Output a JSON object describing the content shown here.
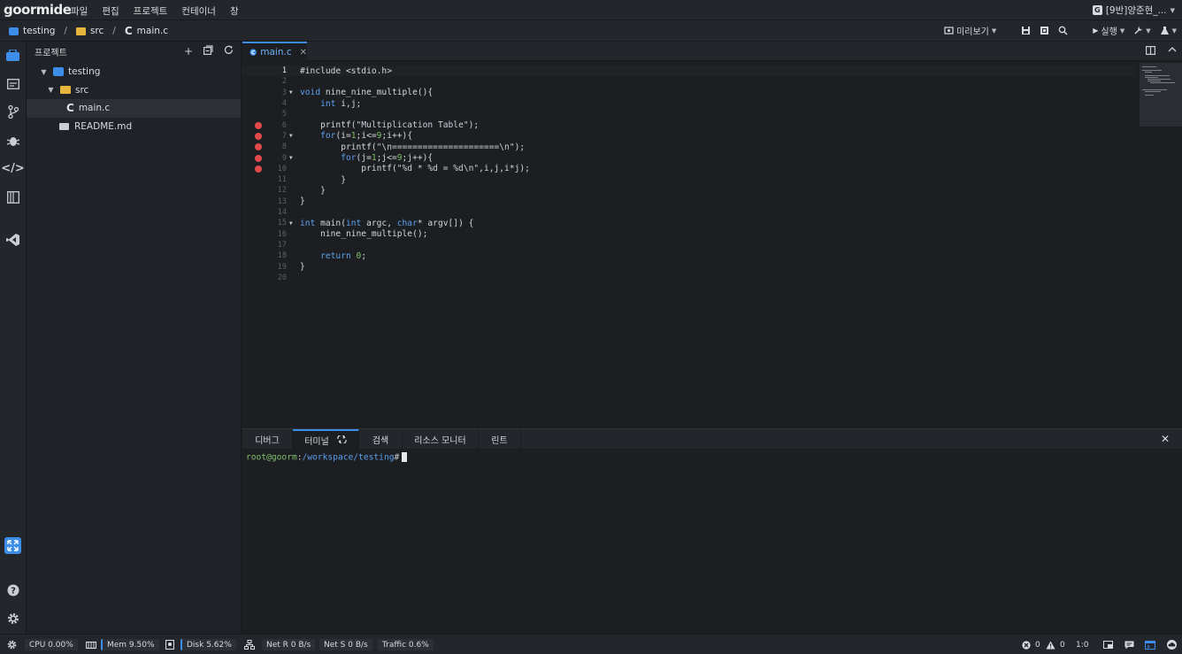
{
  "app": {
    "logo": "goormide"
  },
  "menubar": {
    "items": [
      "파일",
      "편집",
      "프로젝트",
      "컨테이너",
      "창"
    ],
    "account": "[9반]양준현_..."
  },
  "breadcrumb": {
    "project": "testing",
    "folder": "src",
    "file": "main.c"
  },
  "toolbar": {
    "preview_label": "미리보기",
    "run_label": "실행"
  },
  "explorer": {
    "title": "프로젝트",
    "tree": [
      {
        "label": "testing",
        "type": "project"
      },
      {
        "label": "src",
        "type": "folder"
      },
      {
        "label": "main.c",
        "type": "c-file"
      },
      {
        "label": "README.md",
        "type": "md-file"
      }
    ]
  },
  "editor": {
    "tab_label": "main.c",
    "current_line": 1,
    "breakpoint_lines": [
      6,
      7,
      8,
      9,
      10
    ],
    "fold_lines": [
      3,
      7,
      9,
      15
    ],
    "lines": [
      "#include <stdio.h>",
      "",
      "void nine_nine_multiple(){",
      "    int i,j;",
      "",
      "    printf(\"Multiplication Table\");",
      "    for(i=1;i<=9;i++){",
      "        printf(\"\\n=====================\\n\");",
      "        for(j=1;j<=9;j++){",
      "            printf(\"%d * %d = %d\\n\",i,j,i*j);",
      "        }",
      "    }",
      "}",
      "",
      "int main(int argc, char* argv[]) {",
      "    nine_nine_multiple();",
      "",
      "    return 0;",
      "}",
      ""
    ]
  },
  "panel": {
    "tabs": [
      "디버그",
      "터미널",
      "검색",
      "리소스 모니터",
      "린트"
    ],
    "active_tab": "터미널",
    "terminal": {
      "user": "root@goorm",
      "sep": ":",
      "path": "/workspace/testing",
      "prompt": "#"
    }
  },
  "status": {
    "cpu": "CPU 0.00%",
    "mem": "Mem 9.50%",
    "disk": "Disk 5.62%",
    "net_r": "Net R 0 B/s",
    "net_s": "Net S 0 B/s",
    "traffic": "Traffic 0.6%",
    "errors": "0",
    "warnings": "0",
    "cursor_pos": "1:0"
  },
  "colors": {
    "accent": "#3d8ee8",
    "breakpoint": "#e04a4a",
    "folder": "#e7b63c"
  }
}
